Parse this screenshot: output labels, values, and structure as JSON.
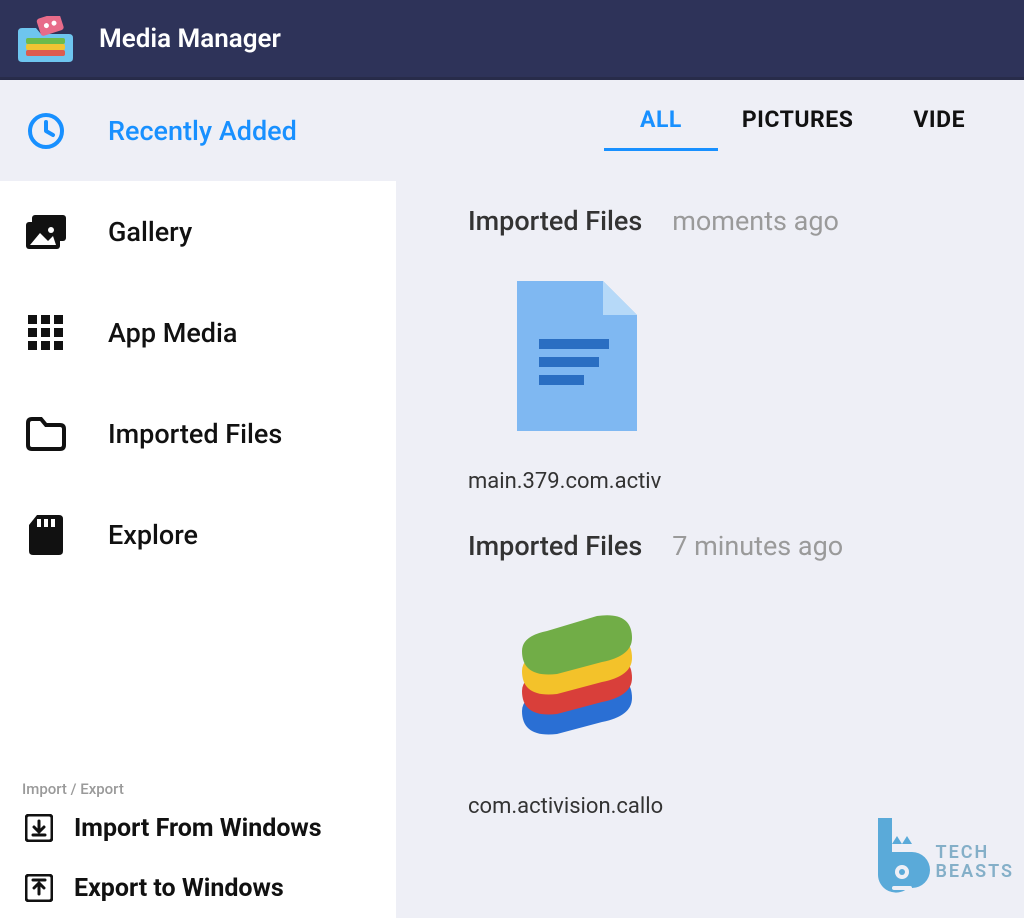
{
  "header": {
    "title": "Media Manager"
  },
  "sidebar": {
    "nav": [
      {
        "label": "Recently Added",
        "icon": "clock-icon",
        "active": true
      },
      {
        "label": "Gallery",
        "icon": "image-folder-icon",
        "active": false
      },
      {
        "label": "App Media",
        "icon": "grid-icon",
        "active": false
      },
      {
        "label": "Imported Files",
        "icon": "folder-icon",
        "active": false
      },
      {
        "label": "Explore",
        "icon": "sdcard-icon",
        "active": false
      }
    ],
    "section_label": "Import / Export",
    "actions": [
      {
        "label": "Import From Windows",
        "icon": "import-icon"
      },
      {
        "label": "Export to Windows",
        "icon": "export-icon"
      }
    ]
  },
  "main": {
    "tabs": [
      {
        "label": "ALL",
        "active": true
      },
      {
        "label": "PICTURES",
        "active": false
      },
      {
        "label": "VIDE",
        "active": false
      }
    ],
    "groups": [
      {
        "title": "Imported Files",
        "time": "moments ago",
        "files": [
          {
            "name": "main.379.com.activ",
            "thumb": "doc-icon"
          }
        ]
      },
      {
        "title": "Imported Files",
        "time": "7 minutes ago",
        "files": [
          {
            "name": "com.activision.callo",
            "thumb": "stack-icon"
          }
        ]
      }
    ]
  },
  "watermark": {
    "line1": "TECH",
    "line2": "BEASTS"
  }
}
